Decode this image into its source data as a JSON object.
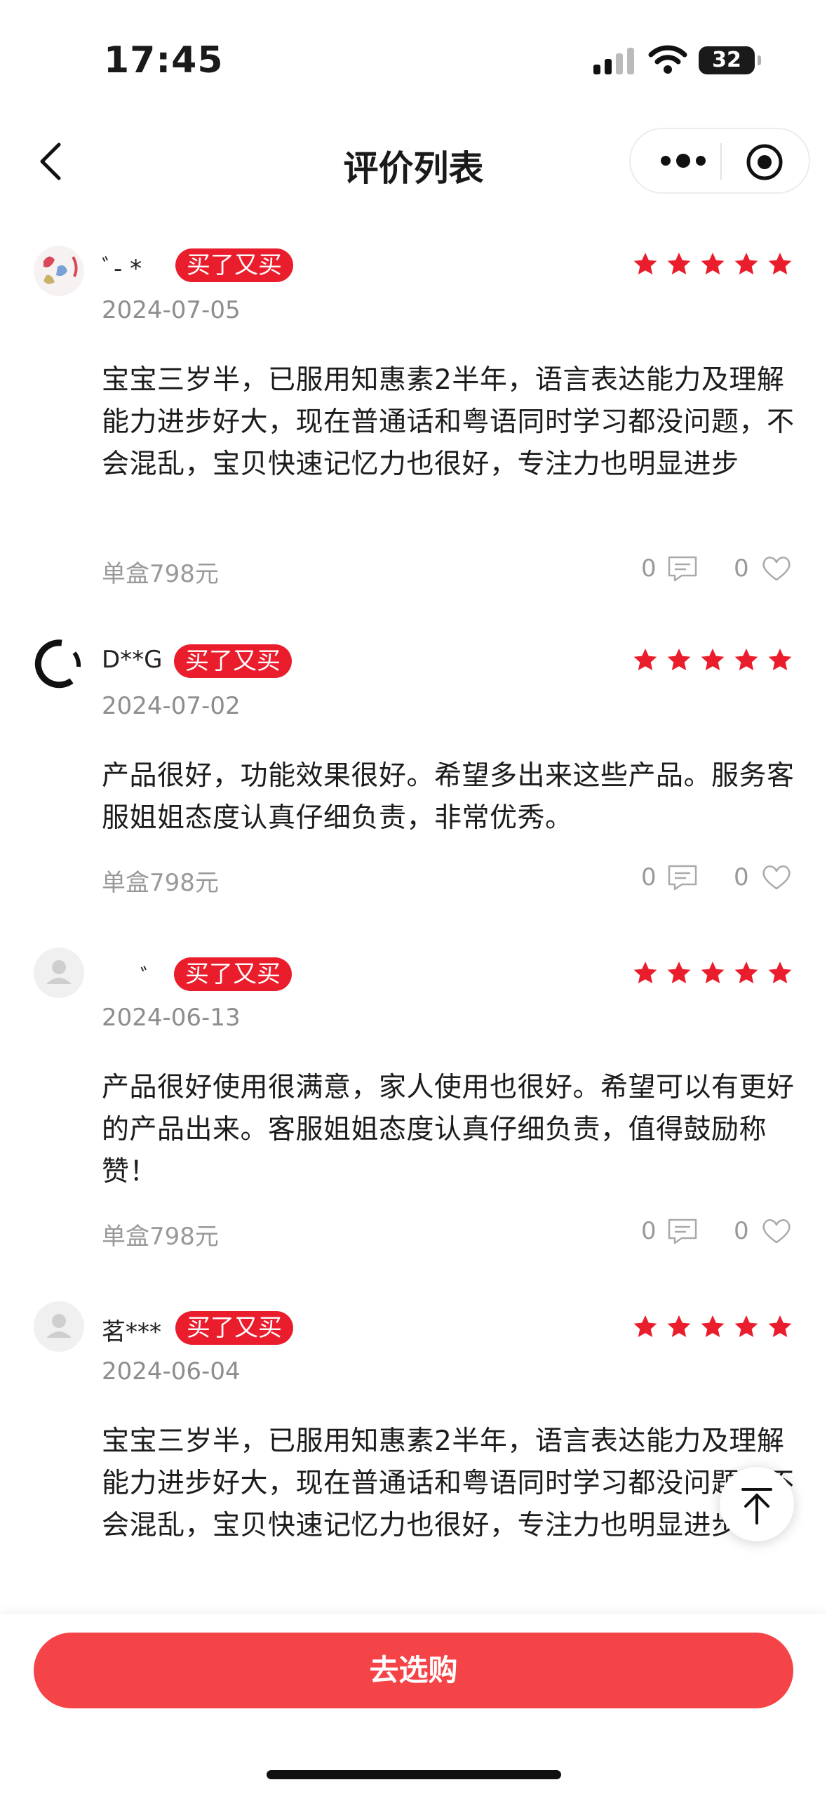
{
  "status_bar": {
    "time": "17:45",
    "battery": "32"
  },
  "nav": {
    "title": "评价列表"
  },
  "reviews": [
    {
      "username": "ﾞ-   *",
      "badge": "买了又买",
      "rating": 5,
      "date": "2024-07-05",
      "content": "宝宝三岁半，已服用知惠素2半年，语言表达能力及理解能力进步好大，现在普通话和粤语同时学习都没问题，不会混乱，宝贝快速记忆力也很好，专注力也明显进步",
      "spec": "单盒798元",
      "comments": "0",
      "likes": "0"
    },
    {
      "username": "D**G",
      "badge": "买了又买",
      "rating": 5,
      "date": "2024-07-02",
      "content": "产品很好，功能效果很好。希望多出来这些产品。服务客服姐姐态度认真仔细负责，非常优秀。",
      "spec": "单盒798元",
      "comments": "0",
      "likes": "0"
    },
    {
      "username": "ﾞ",
      "badge": "买了又买",
      "rating": 5,
      "date": "2024-06-13",
      "content": "产品很好使用很满意，家人使用也很好。希望可以有更好的产品出来。客服姐姐态度认真仔细负责，值得鼓励称赞！",
      "spec": "单盒798元",
      "comments": "0",
      "likes": "0"
    },
    {
      "username": "茗***",
      "badge": "买了又买",
      "rating": 5,
      "date": "2024-06-04",
      "content": "宝宝三岁半，已服用知惠素2半年，语言表达能力及理解能力进步好大，现在普通话和粤语同时学习都没问题，不会混乱，宝贝快速记忆力也很好，专注力也明显进步"
    }
  ],
  "bottom": {
    "buy_label": "去选购"
  },
  "colors": {
    "accent": "#ea1d2c",
    "button": "#f54447",
    "star": "#ea1d2c"
  }
}
